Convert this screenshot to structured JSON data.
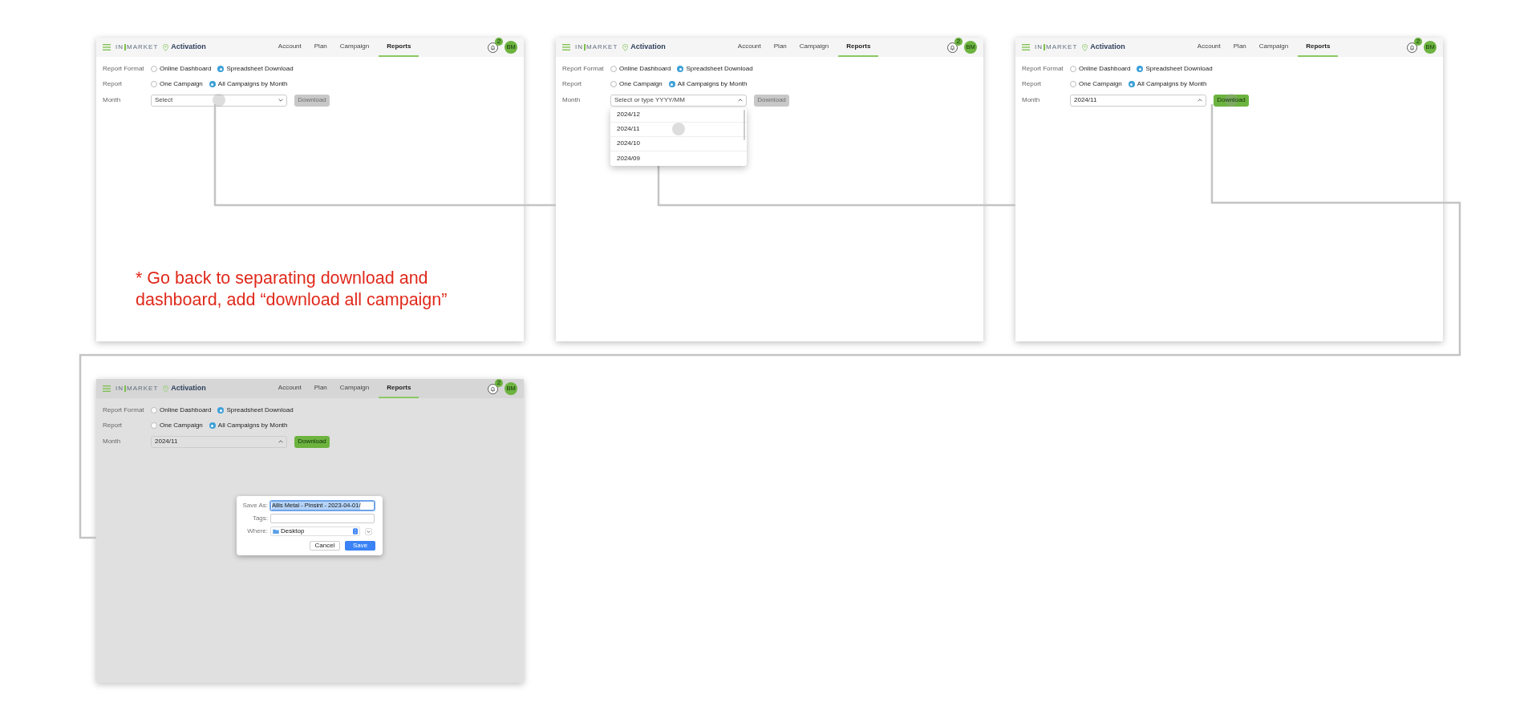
{
  "screens": [
    {
      "dimmed": false,
      "header": {
        "logo_left": "IN",
        "logo_right": "MARKET",
        "app": "Activation",
        "nav": [
          {
            "label": "Account",
            "selected": false
          },
          {
            "label": "Plan",
            "selected": false
          },
          {
            "label": "Campaign",
            "selected": false
          },
          {
            "label": "Reports",
            "selected": true
          }
        ],
        "notifications": "2",
        "avatar": "BM"
      },
      "rows": [
        {
          "label": "Report Format",
          "options": [
            {
              "label": "Online Dashboard",
              "selected": false
            },
            {
              "label": "Spreadsheet Download",
              "selected": true
            }
          ]
        },
        {
          "label": "Report",
          "options": [
            {
              "label": "One Campaign",
              "selected": false
            },
            {
              "label": "All Campaigns by Month",
              "selected": true
            }
          ]
        }
      ],
      "month": {
        "label": "Month",
        "placeholder": "Select",
        "expanded": false,
        "touched": true
      },
      "download": {
        "label": "Download",
        "enabled": false,
        "touched": false
      },
      "note": "* Go back to separating download and dashboard, add “download all campaign”"
    },
    {
      "dimmed": false,
      "header": {
        "logo_left": "IN",
        "logo_right": "MARKET",
        "app": "Activation",
        "nav": [
          {
            "label": "Account",
            "selected": false
          },
          {
            "label": "Plan",
            "selected": false
          },
          {
            "label": "Campaign",
            "selected": false
          },
          {
            "label": "Reports",
            "selected": true
          }
        ],
        "notifications": "2",
        "avatar": "BM"
      },
      "rows": [
        {
          "label": "Report Format",
          "options": [
            {
              "label": "Online Dashboard",
              "selected": false
            },
            {
              "label": "Spreadsheet Download",
              "selected": true
            }
          ]
        },
        {
          "label": "Report",
          "options": [
            {
              "label": "One Campaign",
              "selected": false
            },
            {
              "label": "All Campaigns by Month",
              "selected": true
            }
          ]
        }
      ],
      "month": {
        "label": "Month",
        "placeholder": "Select or type YYYY/MM",
        "expanded": true,
        "touched": false,
        "options": [
          {
            "label": "2024/12",
            "touched": false
          },
          {
            "label": "2024/11",
            "touched": true
          },
          {
            "label": "2024/10",
            "touched": false
          },
          {
            "label": "2024/09",
            "touched": false
          }
        ]
      },
      "download": {
        "label": "Download",
        "enabled": false,
        "touched": false
      }
    },
    {
      "dimmed": false,
      "header": {
        "logo_left": "IN",
        "logo_right": "MARKET",
        "app": "Activation",
        "nav": [
          {
            "label": "Account",
            "selected": false
          },
          {
            "label": "Plan",
            "selected": false
          },
          {
            "label": "Campaign",
            "selected": false
          },
          {
            "label": "Reports",
            "selected": true
          }
        ],
        "notifications": "2",
        "avatar": "BM"
      },
      "rows": [
        {
          "label": "Report Format",
          "options": [
            {
              "label": "Online Dashboard",
              "selected": false
            },
            {
              "label": "Spreadsheet Download",
              "selected": true
            }
          ]
        },
        {
          "label": "Report",
          "options": [
            {
              "label": "One Campaign",
              "selected": false
            },
            {
              "label": "All Campaigns by Month",
              "selected": true
            }
          ]
        }
      ],
      "month": {
        "label": "Month",
        "value": "2024/11",
        "expanded": true,
        "touched": false
      },
      "download": {
        "label": "Download",
        "enabled": true,
        "touched": true
      }
    },
    {
      "dimmed": true,
      "header": {
        "logo_left": "IN",
        "logo_right": "MARKET",
        "app": "Activation",
        "nav": [
          {
            "label": "Account",
            "selected": false
          },
          {
            "label": "Plan",
            "selected": false
          },
          {
            "label": "Campaign",
            "selected": false
          },
          {
            "label": "Reports",
            "selected": true
          }
        ],
        "notifications": "2",
        "avatar": "BM"
      },
      "rows": [
        {
          "label": "Report Format",
          "options": [
            {
              "label": "Online Dashboard",
              "selected": false
            },
            {
              "label": "Spreadsheet Download",
              "selected": true
            }
          ]
        },
        {
          "label": "Report",
          "options": [
            {
              "label": "One Campaign",
              "selected": false
            },
            {
              "label": "All Campaigns by Month",
              "selected": true
            }
          ]
        }
      ],
      "month": {
        "label": "Month",
        "value": "2024/11",
        "expanded": true,
        "touched": false
      },
      "download": {
        "label": "Download",
        "enabled": true,
        "touched": false
      },
      "dialog": {
        "fields": [
          {
            "kind": "text",
            "label": "Save As:",
            "value": "Allis Metal - Pinsint - 2023-04-01/",
            "highlighted": true
          },
          {
            "kind": "text",
            "label": "Tags:",
            "highlighted": false
          },
          {
            "kind": "select",
            "label": "Where:",
            "value": "Desktop"
          }
        ],
        "buttons": [
          {
            "label": "Cancel",
            "primary": false
          },
          {
            "label": "Save",
            "primary": true
          }
        ]
      }
    }
  ]
}
